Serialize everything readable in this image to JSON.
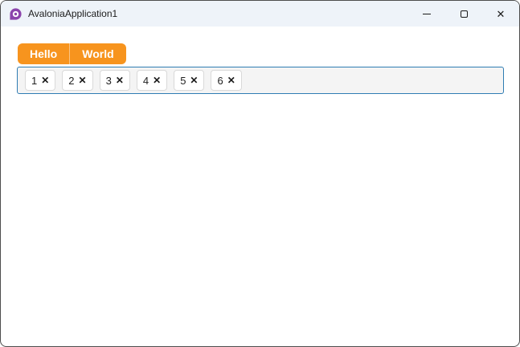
{
  "window": {
    "title": "AvaloniaApplication1"
  },
  "icons": {
    "logo": "avalonia-logo",
    "minimize": "minimize-dash",
    "maximize": "maximize-square",
    "close": "✕",
    "chip_remove": "✕"
  },
  "tabs": [
    {
      "label": "Hello"
    },
    {
      "label": "World"
    }
  ],
  "chips": [
    {
      "label": "1"
    },
    {
      "label": "2"
    },
    {
      "label": "3"
    },
    {
      "label": "4"
    },
    {
      "label": "5"
    },
    {
      "label": "6"
    }
  ],
  "colors": {
    "accent_orange": "#F7941E",
    "focus_border": "#2F7CB3",
    "titlebar_bg": "#EEF3F9",
    "logo_purple": "#8B44AC",
    "window_border": "#4D4D4D",
    "chips_box_bg": "#F4F4F4"
  }
}
